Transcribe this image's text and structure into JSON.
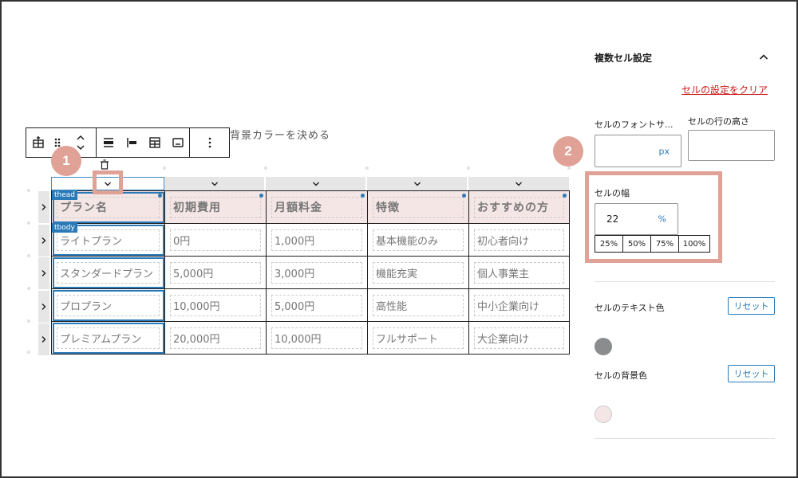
{
  "toolbar": {
    "icons": [
      "table-icon",
      "drag-icon",
      "move-updown-icon",
      "align-center-icon",
      "align-left-icon",
      "table-grid-icon",
      "caption-icon",
      "more-icon"
    ]
  },
  "content": {
    "heading_fragment": "背景カラーを決める"
  },
  "callouts": {
    "first": "1",
    "second": "2"
  },
  "table": {
    "thead_tag": "thead",
    "tbody_tag": "tbody",
    "headers": [
      "プラン名",
      "初期費用",
      "月額料金",
      "特徴",
      "おすすめの方"
    ],
    "rows": [
      [
        "ライトプラン",
        "0円",
        "1,000円",
        "基本機能のみ",
        "初心者向け"
      ],
      [
        "スタンダードプラン",
        "5,000円",
        "3,000円",
        "機能充実",
        "個人事業主"
      ],
      [
        "プロプラン",
        "10,000円",
        "5,000円",
        "高性能",
        "中小企業向け"
      ],
      [
        "プレミアムプラン",
        "20,000円",
        "10,000円",
        "フルサポート",
        "大企業向け"
      ]
    ]
  },
  "sidebar": {
    "title": "複数セル設定",
    "clear_label": "セルの設定をクリア",
    "font_size_label": "セルのフォントサ...",
    "font_size_value": "",
    "font_size_unit": "px",
    "row_height_label": "セルの行の高さ",
    "row_height_value": "",
    "width_label": "セルの幅",
    "width_value": "22",
    "width_unit": "%",
    "width_presets": [
      "25%",
      "50%",
      "75%",
      "100%"
    ],
    "text_color_label": "セルのテキスト色",
    "text_color_reset": "リセット",
    "text_color": "#8a8c8e",
    "bg_color_label": "セルの背景色",
    "bg_color_reset": "リセット",
    "bg_color": "#f5e6e6"
  },
  "colors": {
    "accent": "#2b7ab8",
    "highlight": "#e0a196",
    "danger": "#cc1818"
  }
}
